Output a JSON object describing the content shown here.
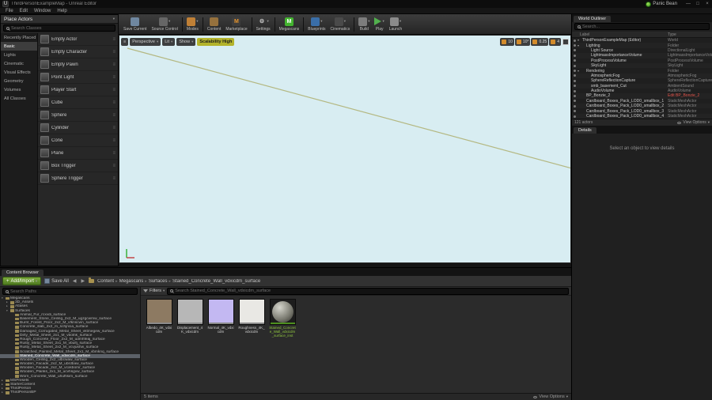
{
  "icons": {
    "dropdown": "▾",
    "menu": "≡",
    "back": "◀",
    "forward": "▶",
    "breadcrumb_sep": "▸",
    "plus": "+",
    "grip": "≡",
    "logo": "U"
  },
  "window": {
    "title": "ThirdPersonExampleMap - Unreal Editor",
    "user_name": "Panic Bean",
    "minimize": "—",
    "maximize": "□",
    "close": "×"
  },
  "menu": {
    "items": [
      {
        "label": "File"
      },
      {
        "label": "Edit"
      },
      {
        "label": "Window"
      },
      {
        "label": "Help"
      }
    ]
  },
  "place_actors": {
    "title": "Place Actors",
    "search_placeholder": "Search Classes",
    "categories": [
      {
        "label": "Recently Placed",
        "cls": ""
      },
      {
        "label": "Basic",
        "cls": "active"
      },
      {
        "label": "Lights",
        "cls": ""
      },
      {
        "label": "Cinematic",
        "cls": ""
      },
      {
        "label": "Visual Effects",
        "cls": ""
      },
      {
        "label": "Geometry",
        "cls": ""
      },
      {
        "label": "Volumes",
        "cls": ""
      },
      {
        "label": "All Classes",
        "cls": ""
      }
    ],
    "items": [
      {
        "label": "Empty Actor"
      },
      {
        "label": "Empty Character"
      },
      {
        "label": "Empty Pawn"
      },
      {
        "label": "Point Light"
      },
      {
        "label": "Player Start"
      },
      {
        "label": "Cube"
      },
      {
        "label": "Sphere"
      },
      {
        "label": "Cylinder"
      },
      {
        "label": "Cone"
      },
      {
        "label": "Plane"
      },
      {
        "label": "Box Trigger"
      },
      {
        "label": "Sphere Trigger"
      }
    ]
  },
  "toolbar": {
    "buttons": [
      {
        "label": "Save Current",
        "color": "#6f87a0",
        "glyph": "",
        "glyph_color": "#ffffff",
        "cls": "",
        "dd": false,
        "sep": false
      },
      {
        "label": "Source Control",
        "color": "#666666",
        "glyph": "",
        "glyph_color": "#ffffff",
        "cls": "",
        "dd": true,
        "sep": false
      },
      {
        "label": "Modes",
        "color": "#c08036",
        "glyph": "",
        "glyph_color": "#ffffff",
        "cls": "",
        "dd": true,
        "sep": true
      },
      {
        "label": "Content",
        "color": "#96713d",
        "glyph": "",
        "glyph_color": "#ffffff",
        "cls": "",
        "dd": false,
        "sep": true
      },
      {
        "label": "Marketplace",
        "color": "#3d3d3d",
        "glyph": "M",
        "glyph_color": "#e8962e",
        "cls": "",
        "dd": false,
        "sep": false
      },
      {
        "label": "Settings",
        "color": "transparent",
        "glyph": "⚙",
        "glyph_color": "#c5c5c5",
        "cls": "",
        "dd": true,
        "sep": true
      },
      {
        "label": "Megascans",
        "color": "#43b32f",
        "glyph": "M",
        "glyph_color": "#ffffff",
        "cls": "",
        "dd": false,
        "sep": true
      },
      {
        "label": "Blueprints",
        "color": "#3a6ea8",
        "glyph": "",
        "glyph_color": "#ffffff",
        "cls": "",
        "dd": true,
        "sep": true
      },
      {
        "label": "Cinematics",
        "color": "#4a4a4a",
        "glyph": "",
        "glyph_color": "#ffffff",
        "cls": "",
        "dd": true,
        "sep": false
      },
      {
        "label": "Build",
        "color": "#7d7d7d",
        "glyph": "",
        "glyph_color": "#ffffff",
        "cls": "",
        "dd": true,
        "sep": true
      },
      {
        "label": "Play",
        "color": "#52b14e",
        "glyph": "",
        "glyph_color": "#ffffff",
        "cls": "icon-play",
        "dd": true,
        "sep": false
      },
      {
        "label": "Launch",
        "color": "#8b8b8b",
        "glyph": "",
        "glyph_color": "#ffffff",
        "cls": "",
        "dd": true,
        "sep": false
      }
    ]
  },
  "viewport": {
    "buttons": [
      {
        "label": "Perspective"
      },
      {
        "label": "Lit"
      },
      {
        "label": "Show"
      }
    ],
    "scalability_label": "Scalability High",
    "snap_controls": [
      {
        "value": "10"
      },
      {
        "value": "10°"
      },
      {
        "value": "0.25"
      },
      {
        "value": "4"
      }
    ],
    "bg_color": "#d8edf2",
    "line_color": "#b4b882"
  },
  "world_outliner": {
    "tab": "World Outliner",
    "search_placeholder": "Search...",
    "columns": {
      "label": "Label",
      "type": "Type"
    },
    "rows": [
      {
        "label": "ThirdPersonExampleMap (Editor)",
        "type": "World",
        "cls": "wind-0",
        "glyph": "▾",
        "type_color": ""
      },
      {
        "label": "Lighting",
        "type": "Folder",
        "cls": "wind-1",
        "glyph": "▾",
        "type_color": ""
      },
      {
        "label": "Light Source",
        "type": "DirectionalLight",
        "cls": "wind-2",
        "glyph": "",
        "type_color": ""
      },
      {
        "label": "LightmassImportanceVolume",
        "type": "LightmassImportanceVolume",
        "cls": "wind-2",
        "glyph": "",
        "type_color": ""
      },
      {
        "label": "PostProcessVolume",
        "type": "PostProcessVolume",
        "cls": "wind-2",
        "glyph": "",
        "type_color": ""
      },
      {
        "label": "SkyLight",
        "type": "SkyLight",
        "cls": "wind-2",
        "glyph": "",
        "type_color": ""
      },
      {
        "label": "Rendering",
        "type": "Folder",
        "cls": "wind-1",
        "glyph": "▾",
        "type_color": ""
      },
      {
        "label": "AtmosphericFog",
        "type": "AtmosphericFog",
        "cls": "wind-2",
        "glyph": "",
        "type_color": ""
      },
      {
        "label": "SphereReflectionCapture",
        "type": "SphereReflectionCapture",
        "cls": "wind-2",
        "glyph": "",
        "type_color": ""
      },
      {
        "label": "smb_basement_Cut",
        "type": "AmbientSound",
        "cls": "wind-2",
        "glyph": "",
        "type_color": ""
      },
      {
        "label": "AudioVolume",
        "type": "AudioVolume",
        "cls": "wind-2",
        "glyph": "",
        "type_color": ""
      },
      {
        "label": "BP_Bonzie_2",
        "type": "Edit BP_Bonzie_2",
        "cls": "wind-1",
        "glyph": "",
        "type_color": "#e0534a"
      },
      {
        "label": "Cardboard_Boxes_Pack_LOD0_smallbox_1",
        "type": "StaticMeshActor",
        "cls": "wind-1",
        "glyph": "",
        "type_color": ""
      },
      {
        "label": "Cardboard_Boxes_Pack_LOD0_smallbox_2",
        "type": "StaticMeshActor",
        "cls": "wind-1",
        "glyph": "",
        "type_color": ""
      },
      {
        "label": "Cardboard_Boxes_Pack_LOD0_smallbox_3",
        "type": "StaticMeshActor",
        "cls": "wind-1",
        "glyph": "",
        "type_color": ""
      },
      {
        "label": "Cardboard_Boxes_Pack_LOD0_smallbox_4",
        "type": "StaticMeshActor",
        "cls": "wind-1",
        "glyph": "",
        "type_color": ""
      }
    ],
    "footer": {
      "count": "121 actors",
      "view_options": "View Options"
    }
  },
  "details": {
    "tab": "Details",
    "empty_text": "Select an object to view details"
  },
  "content_browser": {
    "tab": "Content Browser",
    "add_import_label": "Add/Import",
    "save_all_label": "Save All",
    "breadcrumbs": [
      {
        "label": "Content",
        "sep": true
      },
      {
        "label": "Megascans",
        "sep": true
      },
      {
        "label": "Surfaces",
        "sep": true
      },
      {
        "label": "Stained_Concrete_Wall_vdxicdm_surface",
        "sep": false
      }
    ],
    "paths_search_placeholder": "Search Paths",
    "folders": [
      {
        "name": "Megascans",
        "cls": "ind-0",
        "glyph": "▾"
      },
      {
        "name": "3D_Assets",
        "cls": "ind-1",
        "glyph": "▸"
      },
      {
        "name": "Atlases",
        "cls": "ind-1",
        "glyph": "▸"
      },
      {
        "name": "Surfaces",
        "cls": "ind-1",
        "glyph": "▾"
      },
      {
        "name": "Animal_Fur_rcxvdi_surface",
        "cls": "ind-2",
        "glyph": ""
      },
      {
        "name": "Basement_Stone_Ceiling_2x2_M_ugzgcwmw_surface",
        "cls": "ind-2",
        "glyph": ""
      },
      {
        "name": "Burnt_Forest_Floor_2x2_M_vfknscwn_surface",
        "cls": "ind-2",
        "glyph": ""
      },
      {
        "name": "Concrete_slab_2x2_m_schjncia_surface",
        "cls": "ind-2",
        "glyph": ""
      },
      {
        "name": "Damaged_Corrugated_Metal_Sheet_vktmegew_surface",
        "cls": "ind-2",
        "glyph": ""
      },
      {
        "name": "Dirty_Metal_Sheet_2x1_M_vbolnk_surface",
        "cls": "ind-2",
        "glyph": ""
      },
      {
        "name": "Rough_Concrete_Floor_2x2_M_udmhfeaj_surface",
        "cls": "ind-2",
        "glyph": ""
      },
      {
        "name": "Rusty_Metal_Sheet_2x1_M_vbulfj_surface",
        "cls": "ind-2",
        "glyph": ""
      },
      {
        "name": "Rusty_Metal_Sheet_2x2_M_vcvjushw_surface",
        "cls": "ind-2",
        "glyph": ""
      },
      {
        "name": "Scratched_Painted_Metal_Sheet_2x1_M_vbmknq_surface",
        "cls": "ind-2",
        "glyph": ""
      },
      {
        "name": "Stained_Concrete_Wall_vdxicdm_surface",
        "cls": "ind-2 sel",
        "glyph": ""
      },
      {
        "name": "Wooden_Ceiling_2x2_ulbcwaw_surface",
        "cls": "ind-2",
        "glyph": ""
      },
      {
        "name": "Wooden_Facade_2x2_M_ubrdbaw_surface",
        "cls": "ind-2",
        "glyph": ""
      },
      {
        "name": "Wooden_Facade_2x2_M_vcxkbomr_surface",
        "cls": "ind-2",
        "glyph": ""
      },
      {
        "name": "Wooden_Planks_2x1_M_ucvhsgvw_surface",
        "cls": "ind-2",
        "glyph": ""
      },
      {
        "name": "Worn_Concrete_Wall_uhuffisim_surface",
        "cls": "ind-2",
        "glyph": ""
      },
      {
        "name": "MSPresets",
        "cls": "ind-0",
        "glyph": "▸"
      },
      {
        "name": "StarterContent",
        "cls": "ind-0",
        "glyph": "▸"
      },
      {
        "name": "ThirdPerson",
        "cls": "ind-0",
        "glyph": "▸"
      },
      {
        "name": "ThirdPersonBP",
        "cls": "ind-0",
        "glyph": "▸"
      }
    ],
    "filters_label": "Filters",
    "assets_search_placeholder": "Search Stained_Concrete_Wall_vdxicdm_surface",
    "assets": [
      {
        "name": "Albedo_4K_vdxicdm",
        "color": "#8d7a62",
        "edge": "#8a8a8a",
        "name_color": "#cfcfcf",
        "sphere": false
      },
      {
        "name": "Displacement_4K_vdxicdm",
        "color": "#b7b7b7",
        "edge": "#8a8a8a",
        "name_color": "#cfcfcf",
        "sphere": false
      },
      {
        "name": "Normal_4K_vdxicdm",
        "color": "#c3b8f2",
        "edge": "#8a8a8a",
        "name_color": "#cfcfcf",
        "sphere": false
      },
      {
        "name": "Roughness_4K_vdxicdm",
        "color": "#e9e8e4",
        "edge": "#8a8a8a",
        "name_color": "#cfcfcf",
        "sphere": false
      },
      {
        "name": "Stained_Concrete_Wall_vdxicdm_surface_inst",
        "color": "#1d1d1d",
        "edge": "#4e8f1f",
        "name_color": "#8fc63f",
        "sphere": true
      }
    ],
    "footer": {
      "count": "5 items",
      "view_options": "View Options"
    }
  }
}
